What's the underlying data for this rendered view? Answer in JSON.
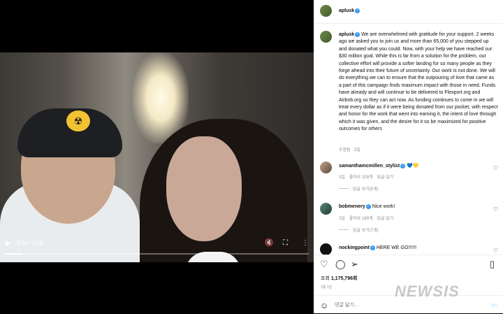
{
  "video": {
    "time": "0:04 / 1:08",
    "progress": 0.06
  },
  "header": {
    "username": "aplusk"
  },
  "caption": {
    "username": "aplusk",
    "text": "We are overwhelmed with gratitude for your support. 2 weeks ago we asked you to join us and more than 65,000 of you stepped up and donated what you could. Now, with your help we have reached our $30 million goal. While this is far from a solution for the problem, our collective effort will provide a softer landing for so many people as they forge ahead into their future of uncertainty. Our work is not done. We will do everything we can to ensure that the outpouring of love that came as a part of this campaign finds maximum impact with those in need. Funds have already and will continue to be delivered to Flexport.org and Airbnb.org so they can act now. As funding continues to come in we will treat every dollar as if it were being donated from our pocket, with respect and honor for the work that went into earning it, the intent of love through which it was given, and the desire for it so be maximized for positive outcomes for others",
    "meta": "수정됨 · 3일"
  },
  "comments": [
    {
      "username": "samanthamcmillen_stylist",
      "text": "💙💛",
      "age": "3일",
      "likes": "좋아요 328개",
      "reply": "답글 달기",
      "replies": "답글 보기(5개)"
    },
    {
      "username": "bobmenery",
      "text": "Nice work!",
      "age": "3일",
      "likes": "좋아요 189개",
      "reply": "답글 달기",
      "replies": "답글 보기(7개)"
    },
    {
      "username": "nockingpoint",
      "text": "HERE WE GO!!!!!!"
    }
  ],
  "actions": {
    "views_label": "조회",
    "views_count": "1,175,796회",
    "posted": "3월 1일"
  },
  "comment_box": {
    "placeholder": "댓글 달기...",
    "post_label": "게시"
  },
  "watermark": "NEWSIS"
}
